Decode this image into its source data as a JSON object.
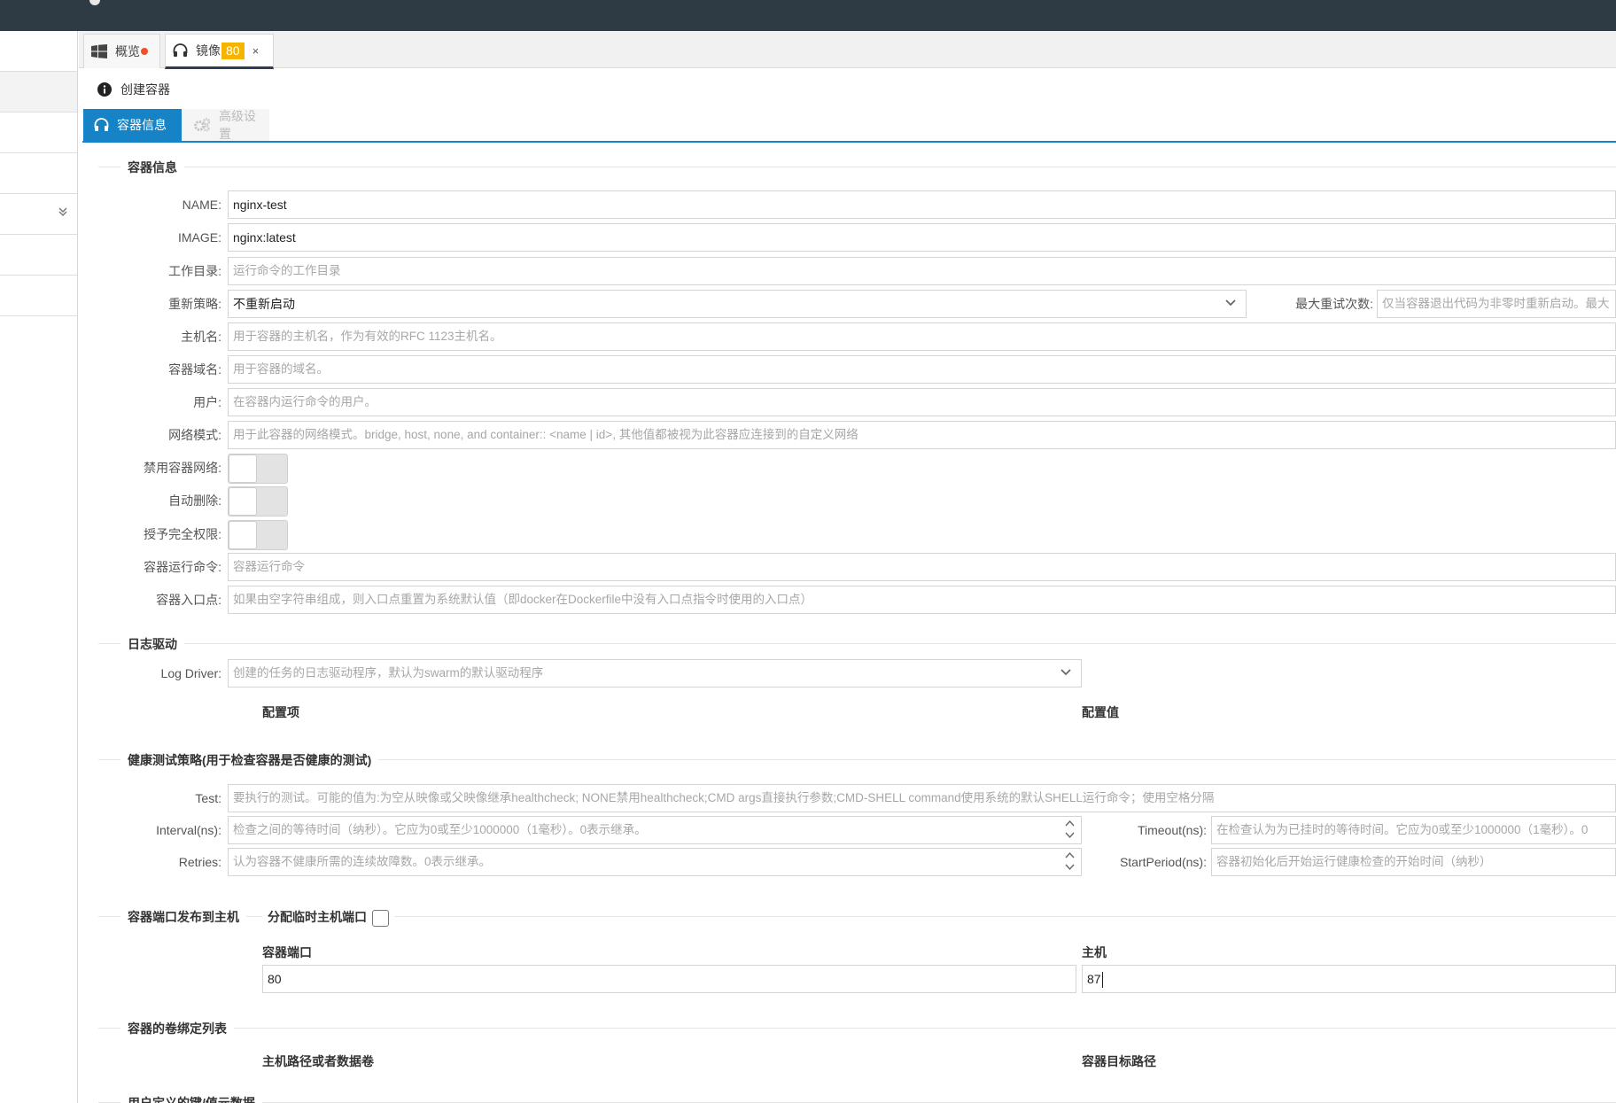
{
  "tabs": [
    {
      "label": "概览",
      "icon": "windows-icon",
      "indicator": "unsaved-dot"
    },
    {
      "label": "镜像",
      "icon": "headset-icon",
      "badge": "80",
      "close": "×"
    }
  ],
  "panel": {
    "title": "创建容器",
    "icon": "info-circle-icon"
  },
  "subtabs": [
    {
      "label": "容器信息",
      "icon": "headset-icon",
      "active": true
    },
    {
      "label": "高级设置",
      "icon": "gears-icon",
      "active": false
    }
  ],
  "sections": {
    "container_info": "容器信息",
    "log_driver": "日志驱动",
    "health": "健康测试策略(用于检查容器是否健康的测试)",
    "ports": "容器端口发布到主机",
    "ports_ephemeral": "分配临时主机端口",
    "volumes": "容器的卷绑定列表",
    "labels": "用户定义的键/值元数据"
  },
  "fields": {
    "name": {
      "label": "NAME:",
      "value": "nginx-test"
    },
    "image": {
      "label": "IMAGE:",
      "value": "nginx:latest"
    },
    "workdir": {
      "label": "工作目录:",
      "placeholder": "运行命令的工作目录"
    },
    "restart": {
      "label": "重新策略:",
      "value": "不重新启动"
    },
    "max_retry": {
      "label": "最大重试次数:",
      "placeholder": "仅当容器退出代码为非零时重新启动。最大"
    },
    "hostname": {
      "label": "主机名:",
      "placeholder": "用于容器的主机名，作为有效的RFC 1123主机名。"
    },
    "domain": {
      "label": "容器域名:",
      "placeholder": "用于容器的域名。"
    },
    "user": {
      "label": "用户:",
      "placeholder": "在容器内运行命令的用户。"
    },
    "network": {
      "label": "网络模式:",
      "placeholder": "用于此容器的网络模式。bridge, host, none, and container:: <name | id>, 其他值都被视为此容器应连接到的自定义网络"
    },
    "disable_net": {
      "label": "禁用容器网络:",
      "on": false
    },
    "auto_remove": {
      "label": "自动删除:",
      "on": false
    },
    "privileged": {
      "label": "授予完全权限:",
      "on": false
    },
    "cmd": {
      "label": "容器运行命令:",
      "placeholder": "容器运行命令"
    },
    "entrypoint": {
      "label": "容器入口点:",
      "placeholder": "如果由空字符串组成，则入口点重置为系统默认值（即docker在Dockerfile中没有入口点指令时使用的入口点）"
    },
    "log_driver": {
      "label": "Log Driver:",
      "placeholder": "创建的任务的日志驱动程序，默认为swarm的默认驱动程序"
    },
    "test": {
      "label": "Test:",
      "placeholder": "要执行的测试。可能的值为:为空从映像或父映像继承healthcheck; NONE禁用healthcheck;CMD args直接执行参数;CMD-SHELL command使用系统的默认SHELL运行命令；使用空格分隔"
    },
    "interval": {
      "label": "Interval(ns):",
      "placeholder": "检查之间的等待时间（纳秒）。它应为0或至少1000000（1毫秒）。0表示继承。"
    },
    "timeout": {
      "label": "Timeout(ns):",
      "placeholder": "在检查认为为已挂时的等待时间。它应为0或至少1000000（1毫秒）。0"
    },
    "retries": {
      "label": "Retries:",
      "placeholder": "认为容器不健康所需的连续故障数。0表示继承。"
    },
    "start_period": {
      "label": "StartPeriod(ns):",
      "placeholder": "容器初始化后开始运行健康检查的开始时间（纳秒）"
    }
  },
  "log_config_cols": {
    "key": "配置项",
    "value": "配置值"
  },
  "ports": {
    "col_container": "容器端口",
    "col_host": "主机",
    "container_port": "80",
    "host_port": "87"
  },
  "volumes_cols": {
    "host": "主机路径或者数据卷",
    "target": "容器目标路径"
  }
}
